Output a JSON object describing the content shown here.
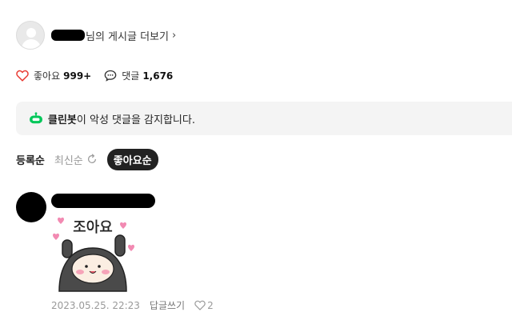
{
  "author": {
    "suffix_text": "님의 게시글 더보기",
    "chevron": "›"
  },
  "stats": {
    "like_label": "좋아요",
    "like_count": "999+",
    "comment_label": "댓글",
    "comment_count": "1,676"
  },
  "cleanbot": {
    "name": "클린봇",
    "message": "이 악성 댓글을 감지합니다."
  },
  "sort": {
    "registered": "등록순",
    "recent": "최신순",
    "liked": "좋아요순"
  },
  "comment": {
    "sticker_text": "조아요",
    "date": "2023.05.25. 22:23",
    "reply_label": "답글쓰기",
    "like_count": "2"
  },
  "colors": {
    "heart": "#e8382f",
    "cleanbot_green": "#03c75a",
    "sticker_heart": "#f28ab2"
  },
  "icons": {
    "author_avatar": "default-avatar-icon",
    "like": "heart-outline-icon",
    "comment": "speech-bubble-icon",
    "cleanbot": "robot-icon",
    "refresh": "refresh-icon",
    "comment_like": "heart-outline-icon"
  }
}
